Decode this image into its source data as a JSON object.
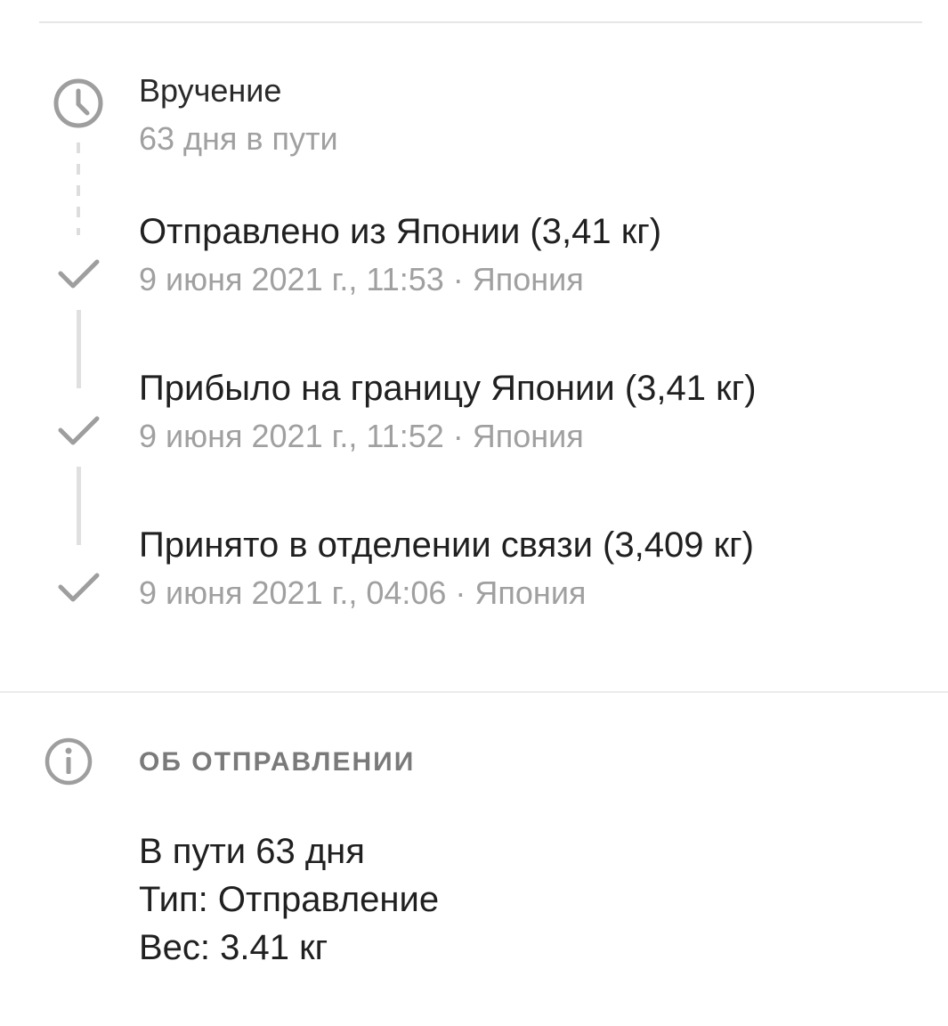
{
  "colors": {
    "primary_text": "#202020",
    "secondary_text": "#a0a0a0",
    "icon_gray": "#9e9e9e",
    "divider": "#e6e6e6",
    "heading_gray": "#7a7a7a"
  },
  "timeline": {
    "events": [
      {
        "icon": "clock-icon",
        "title": "Вручение",
        "subtitle": "63 дня в пути"
      },
      {
        "icon": "check-icon",
        "title": "Отправлено из Японии (3,41 кг)",
        "subtitle": "9 июня 2021 г., 11:53 · Япония"
      },
      {
        "icon": "check-icon",
        "title": "Прибыло на границу Японии (3,41 кг)",
        "subtitle": "9 июня 2021 г., 11:52 · Япония"
      },
      {
        "icon": "check-icon",
        "title": "Принято в отделении связи (3,409 кг)",
        "subtitle": "9 июня 2021 г., 04:06 · Япония"
      }
    ]
  },
  "about": {
    "icon": "info-icon",
    "heading": "ОБ ОТПРАВЛЕНИИ",
    "lines": [
      "В пути 63 дня",
      "Тип: Отправление",
      "Вес: 3.41 кг"
    ]
  }
}
